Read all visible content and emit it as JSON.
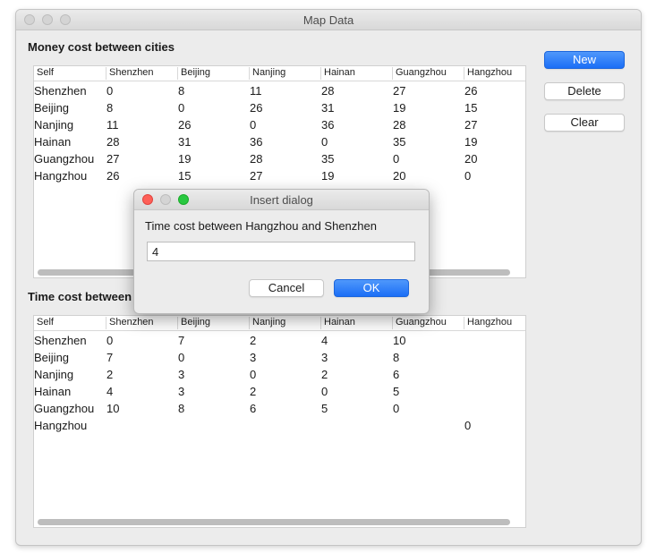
{
  "window": {
    "title": "Map Data"
  },
  "money": {
    "title": "Money cost between cities",
    "headers": [
      "Self",
      "Shenzhen",
      "Beijing",
      "Nanjing",
      "Hainan",
      "Guangzhou",
      "Hangzhou"
    ],
    "rows": [
      [
        "Shenzhen",
        "0",
        "8",
        "11",
        "28",
        "27",
        "26"
      ],
      [
        "Beijing",
        "8",
        "0",
        "26",
        "31",
        "19",
        "15"
      ],
      [
        "Nanjing",
        "11",
        "26",
        "0",
        "36",
        "28",
        "27"
      ],
      [
        "Hainan",
        "28",
        "31",
        "36",
        "0",
        "35",
        "19"
      ],
      [
        "Guangzhou",
        "27",
        "19",
        "28",
        "35",
        "0",
        "20"
      ],
      [
        "Hangzhou",
        "26",
        "15",
        "27",
        "19",
        "20",
        "0"
      ]
    ]
  },
  "time": {
    "title": "Time cost between",
    "headers": [
      "Self",
      "Shenzhen",
      "Beijing",
      "Nanjing",
      "Hainan",
      "Guangzhou",
      "Hangzhou"
    ],
    "rows": [
      [
        "Shenzhen",
        "0",
        "7",
        "2",
        "4",
        "10",
        ""
      ],
      [
        "Beijing",
        "7",
        "0",
        "3",
        "3",
        "8",
        ""
      ],
      [
        "Nanjing",
        "2",
        "3",
        "0",
        "2",
        "6",
        ""
      ],
      [
        "Hainan",
        "4",
        "3",
        "2",
        "0",
        "5",
        ""
      ],
      [
        "Guangzhou",
        "10",
        "8",
        "6",
        "5",
        "0",
        ""
      ],
      [
        "Hangzhou",
        "",
        "",
        "",
        "",
        "",
        "0"
      ]
    ]
  },
  "buttons": {
    "new": "New",
    "delete": "Delete",
    "clear": "Clear"
  },
  "dialog": {
    "title": "Insert dialog",
    "prompt": "Time cost between Hangzhou and Shenzhen",
    "value": "4",
    "cancel": "Cancel",
    "ok": "OK"
  },
  "colors": {
    "accent": "#1b6ef6",
    "close": "#fe5f57",
    "zoom": "#28c840"
  }
}
